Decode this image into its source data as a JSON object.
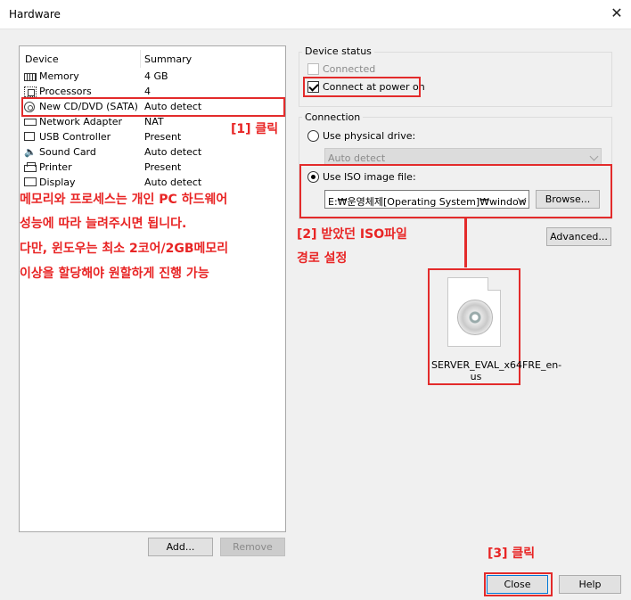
{
  "window": {
    "title": "Hardware",
    "close_glyph": "✕"
  },
  "device_list": {
    "col_device": "Device",
    "col_summary": "Summary",
    "rows": [
      {
        "name": "Memory",
        "summary": "4 GB",
        "icon": "memory-icon"
      },
      {
        "name": "Processors",
        "summary": "4",
        "icon": "processor-icon"
      },
      {
        "name": "New CD/DVD (SATA)",
        "summary": "Auto detect",
        "icon": "cd-dvd-icon"
      },
      {
        "name": "Network Adapter",
        "summary": "NAT",
        "icon": "network-adapter-icon"
      },
      {
        "name": "USB Controller",
        "summary": "Present",
        "icon": "usb-controller-icon"
      },
      {
        "name": "Sound Card",
        "summary": "Auto detect",
        "icon": "sound-card-icon"
      },
      {
        "name": "Printer",
        "summary": "Present",
        "icon": "printer-icon"
      },
      {
        "name": "Display",
        "summary": "Auto detect",
        "icon": "display-icon"
      }
    ],
    "add_label": "Add...",
    "remove_label": "Remove"
  },
  "device_status": {
    "title": "Device status",
    "connected_label": "Connected",
    "connected_checked": false,
    "connect_power_label": "Connect at power on",
    "connect_power_checked": true
  },
  "connection": {
    "title": "Connection",
    "physical_label": "Use physical drive:",
    "physical_value": "Auto detect",
    "iso_label": "Use ISO image file:",
    "iso_value": "E:₩운영체제[Operating System]₩window",
    "browse_label": "Browse...",
    "advanced_label": "Advanced..."
  },
  "annotations": {
    "step1": "[1] 클릭",
    "note_lines": [
      "메모리와 프로세스는 개인 PC 하드웨어",
      "성능에 따라 늘려주시면 됩니다.",
      "다만, 윈도우는 최소 2코어/2GB메모리",
      "이상을 할당해야 원할하게 진행 가능"
    ],
    "step2_line1": "[2] 받았던 ISO파일",
    "step2_line2": "경로 설정",
    "step3": "[3] 클릭",
    "iso_file_name": "SERVER_EVAL_x64FRE_en-us"
  },
  "footer": {
    "close_label": "Close",
    "help_label": "Help"
  },
  "colors": {
    "annotation_red": "#e32b2b",
    "focus_blue": "#0078d7"
  }
}
